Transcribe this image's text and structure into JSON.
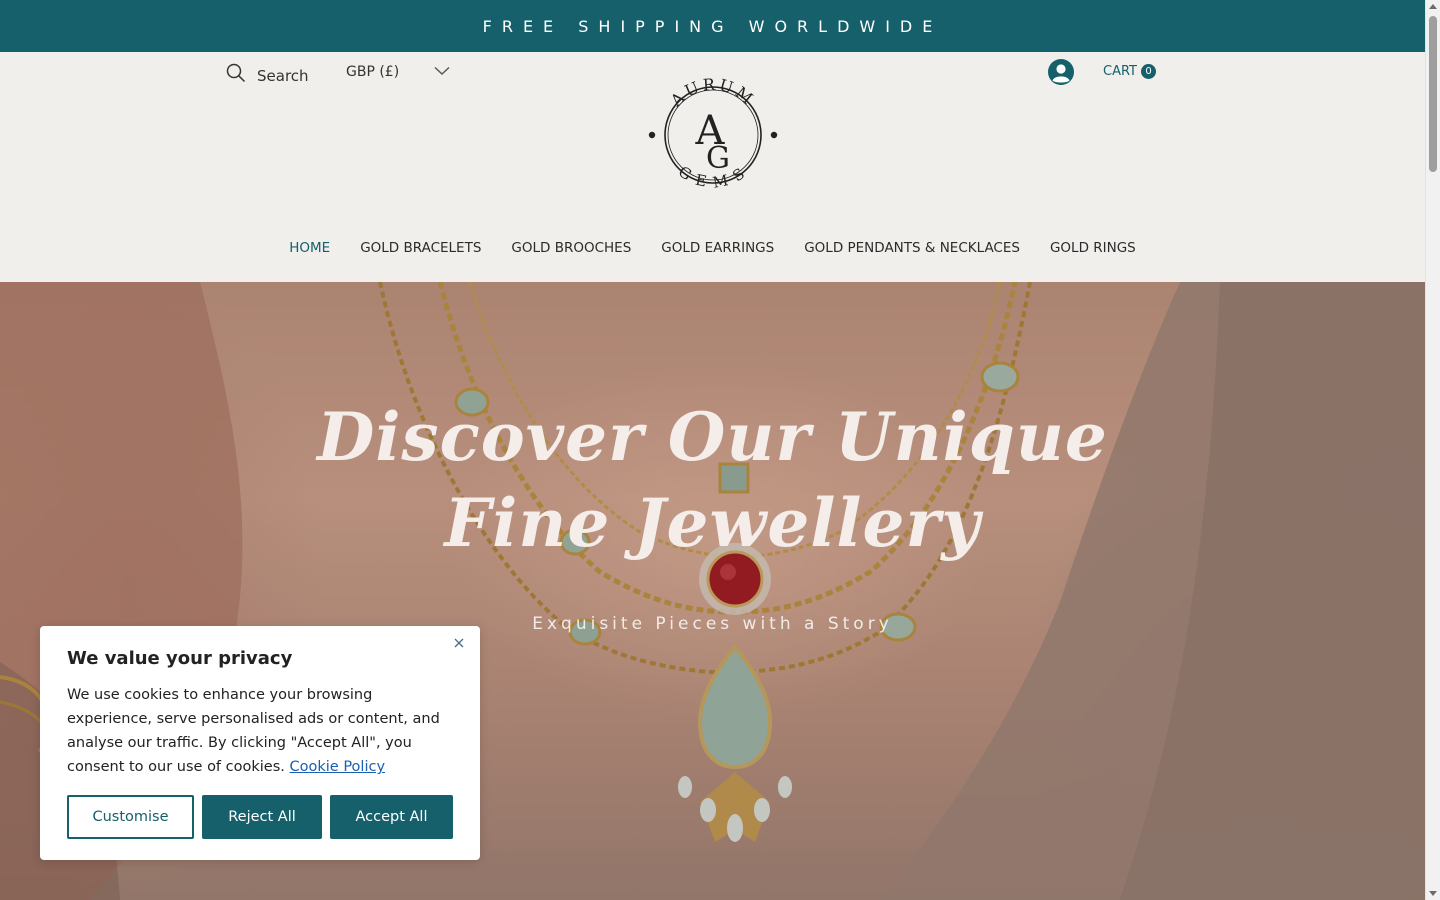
{
  "announcement": {
    "text": "FREE SHIPPING WORLDWIDE"
  },
  "header": {
    "search_label": "Search",
    "currency": "GBP (£)",
    "cart_label": "CART",
    "cart_count": "0",
    "logo": {
      "top_text": "AURUM",
      "bottom_text": "GEMS",
      "monogram_a": "A",
      "monogram_g": "G"
    }
  },
  "nav": {
    "items": [
      {
        "label": "HOME",
        "active": true
      },
      {
        "label": "GOLD BRACELETS"
      },
      {
        "label": "GOLD BROOCHES"
      },
      {
        "label": "GOLD EARRINGS"
      },
      {
        "label": "GOLD PENDANTS & NECKLACES"
      },
      {
        "label": "GOLD RINGS"
      }
    ]
  },
  "hero": {
    "title_line1": "Discover Our Unique",
    "title_line2": "Fine Jewellery",
    "subtitle": "Exquisite Pieces with a Story"
  },
  "cookie": {
    "title": "We value your privacy",
    "body": "We use cookies to enhance your browsing experience, serve personalised ads or content, and analyse our traffic. By clicking \"Accept All\", you consent to our use of cookies.",
    "policy_link": "Cookie Policy",
    "customise_label": "Customise",
    "reject_label": "Reject All",
    "accept_label": "Accept All"
  },
  "colors": {
    "brand": "#15606b",
    "background": "#f0efec",
    "link": "#1a5fb4"
  },
  "icons": [
    "search-icon",
    "chevron-down-icon",
    "account-icon",
    "close-icon"
  ]
}
